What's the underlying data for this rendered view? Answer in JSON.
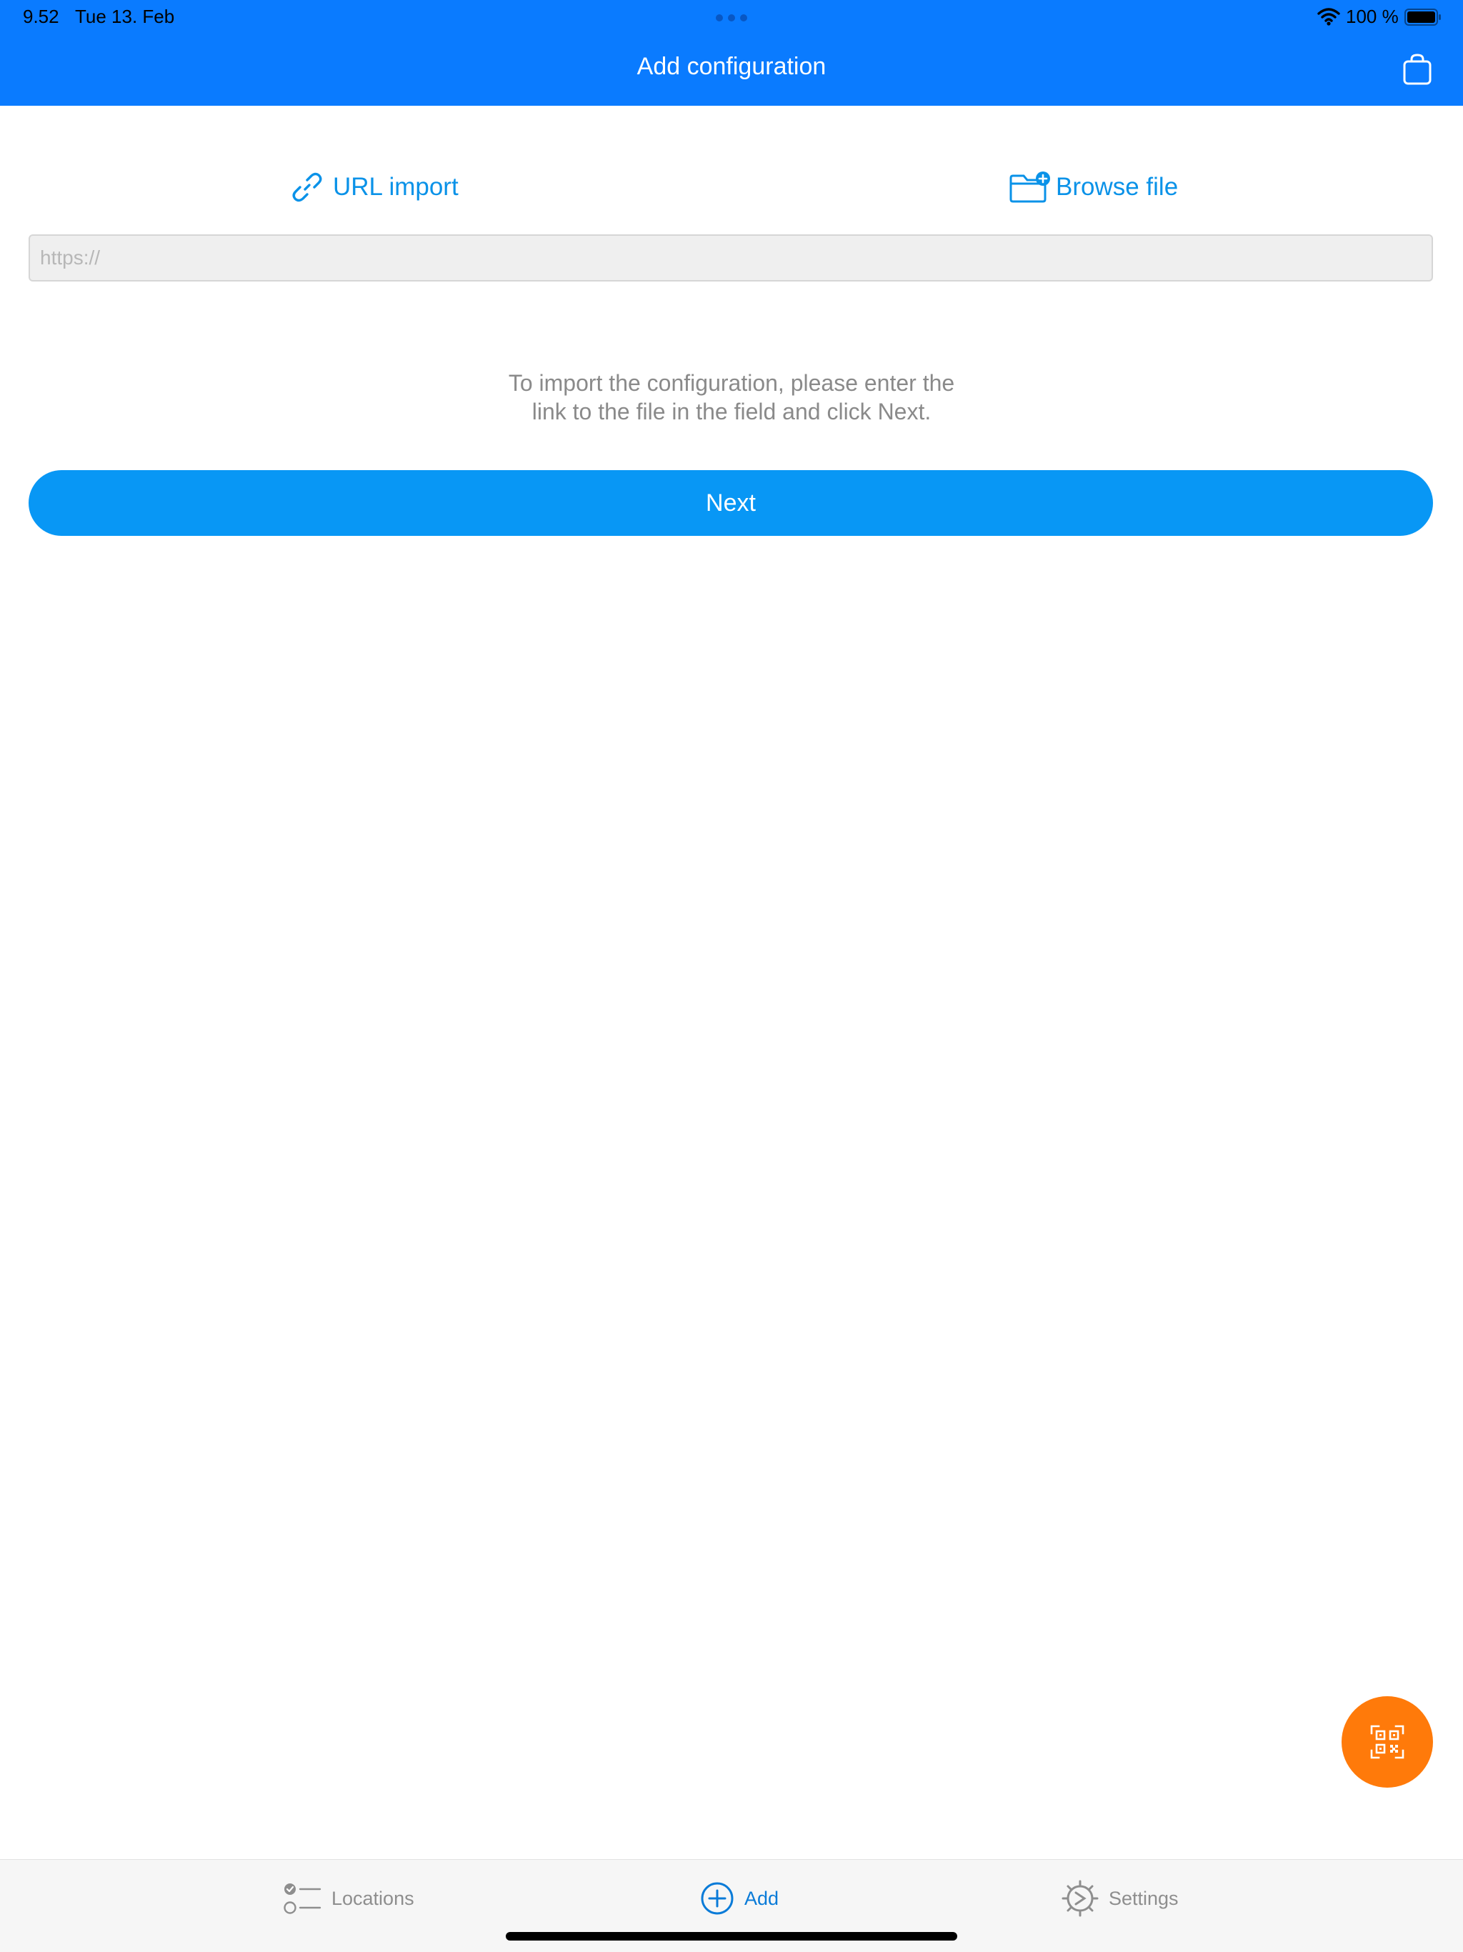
{
  "status_bar": {
    "time": "9.52",
    "date": "Tue 13. Feb",
    "battery": "100 %"
  },
  "header": {
    "title": "Add configuration"
  },
  "segments": {
    "url_import_label": "URL import",
    "browse_file_label": "Browse file"
  },
  "url_input": {
    "placeholder": "https://",
    "value": ""
  },
  "instruction": {
    "line1": "To import the configuration, please enter the",
    "line2": "link to the file in the field and click Next."
  },
  "next_button": {
    "label": "Next"
  },
  "tabbar": {
    "items": [
      {
        "label": "Locations",
        "icon": "checklist-icon",
        "active": false
      },
      {
        "label": "Add",
        "icon": "plus-circle-icon",
        "active": true
      },
      {
        "label": "Settings",
        "icon": "gear-icon",
        "active": false
      }
    ]
  },
  "colors": {
    "header_bg": "#0a7bff",
    "accent_blue": "#0a92e8",
    "next_button_bg": "#0897f5",
    "fab_orange": "#ff7a0a",
    "inactive_gray": "#8e8e8e"
  },
  "icons": {
    "header_action": "shopping-bag-icon",
    "fab": "qr-code-icon",
    "url_import": "link-icon",
    "browse_file": "folder-add-icon"
  }
}
